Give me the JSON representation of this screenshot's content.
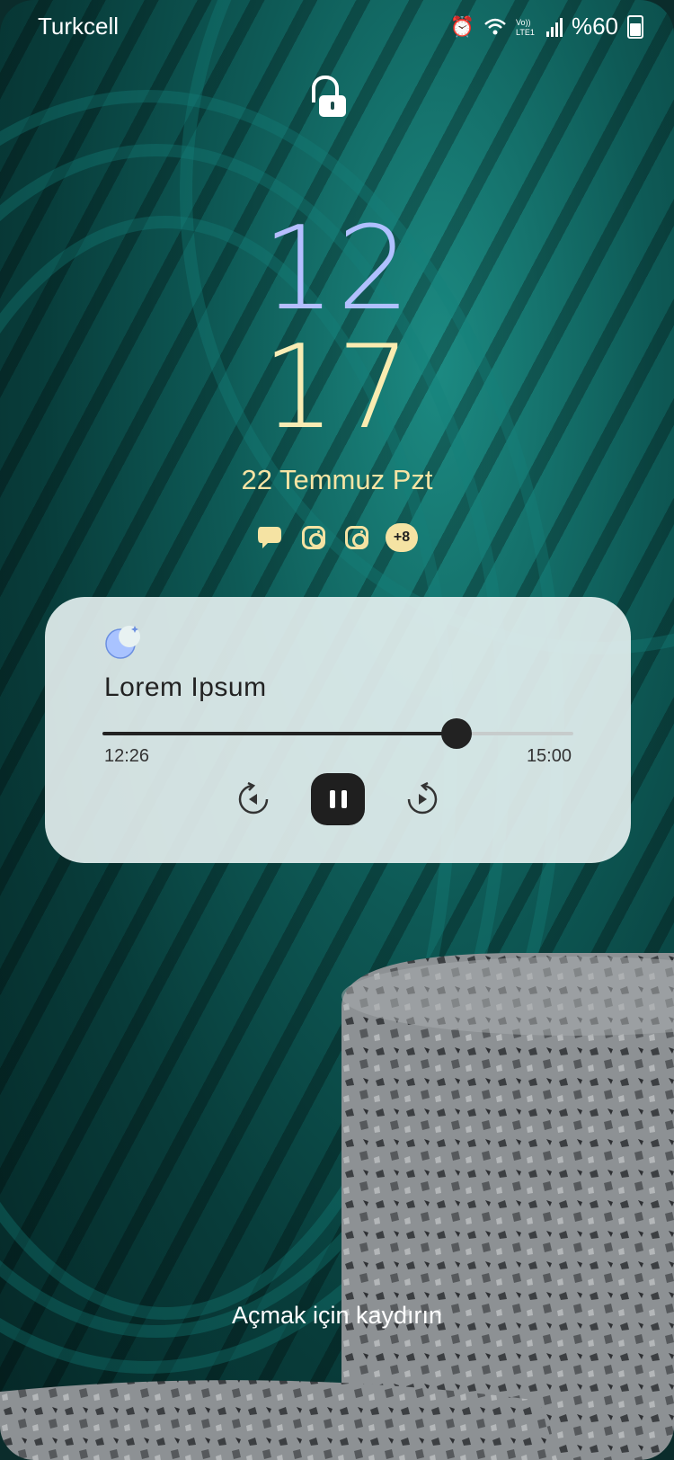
{
  "status_bar": {
    "carrier": "Turkcell",
    "battery": "%60",
    "icons": [
      "alarm-icon",
      "wifi-icon",
      "volte-icon",
      "signal-icon",
      "battery-icon"
    ]
  },
  "lock": {
    "icon": "unlock-icon"
  },
  "clock": {
    "hour": "12",
    "minute": "17",
    "date": "22 Temmuz Pzt"
  },
  "notifications": {
    "icons": [
      "chat-icon",
      "instagram-icon",
      "instagram-icon"
    ],
    "more": "+8"
  },
  "media_player": {
    "app_icon": "moon-app-icon",
    "title": "Lorem Ipsum",
    "elapsed": "12:26",
    "total": "15:00",
    "progress": 0.752,
    "controls": {
      "rewind": "rewind-icon",
      "pause": "pause-icon",
      "forward": "forward-icon"
    }
  },
  "hint": "Açmak için kaydırın",
  "colors": {
    "hour_gradient": [
      "#c6b7ff",
      "#9fc8ff"
    ],
    "minute_gradient": [
      "#f3f0c4",
      "#ffe8a1"
    ],
    "date": "#f6e4a4",
    "card": "#e8f2f2"
  }
}
